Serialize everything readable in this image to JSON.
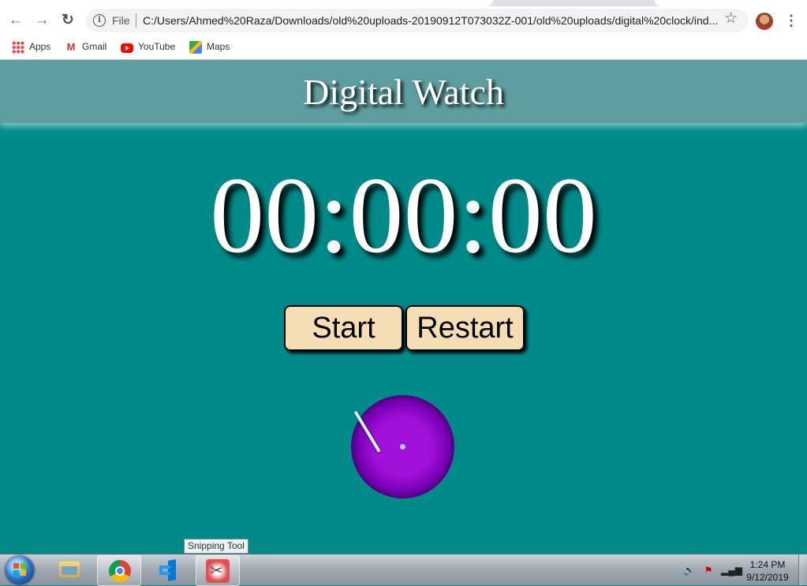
{
  "browser": {
    "omnibox": {
      "info_icon": "info-icon",
      "scheme_label": "File",
      "url": "C:/Users/Ahmed%20Raza/Downloads/old%20uploads-20190912T073032Z-001/old%20uploads/digital%20clock/ind..."
    },
    "nav": {
      "back_icon": "←",
      "forward_icon": "→",
      "reload_icon": "↻"
    },
    "star_icon": "☆",
    "menu_icon": "⋮"
  },
  "bookmarks": [
    {
      "label": "Apps",
      "icon": "apps-grid-icon"
    },
    {
      "label": "Gmail",
      "icon": "gmail-icon"
    },
    {
      "label": "YouTube",
      "icon": "youtube-icon"
    },
    {
      "label": "Maps",
      "icon": "maps-icon"
    }
  ],
  "page": {
    "title": "Digital Watch",
    "time": "00:00:00",
    "buttons": {
      "start": "Start",
      "restart": "Restart"
    },
    "colors": {
      "background": "#008b8a",
      "header": "#5f9ea0",
      "button": "#f5deb3",
      "dial": "#8b00d0"
    }
  },
  "taskbar": {
    "tooltip": "Snipping Tool",
    "apps": [
      {
        "name": "Windows Explorer",
        "icon": "folder-icon"
      },
      {
        "name": "Google Chrome",
        "icon": "chrome-icon"
      },
      {
        "name": "Visual Studio Code",
        "icon": "vscode-icon"
      },
      {
        "name": "Snipping Tool",
        "icon": "scissors-icon"
      }
    ],
    "clock": {
      "time": "1:24 PM",
      "date": "9/12/2019"
    }
  }
}
